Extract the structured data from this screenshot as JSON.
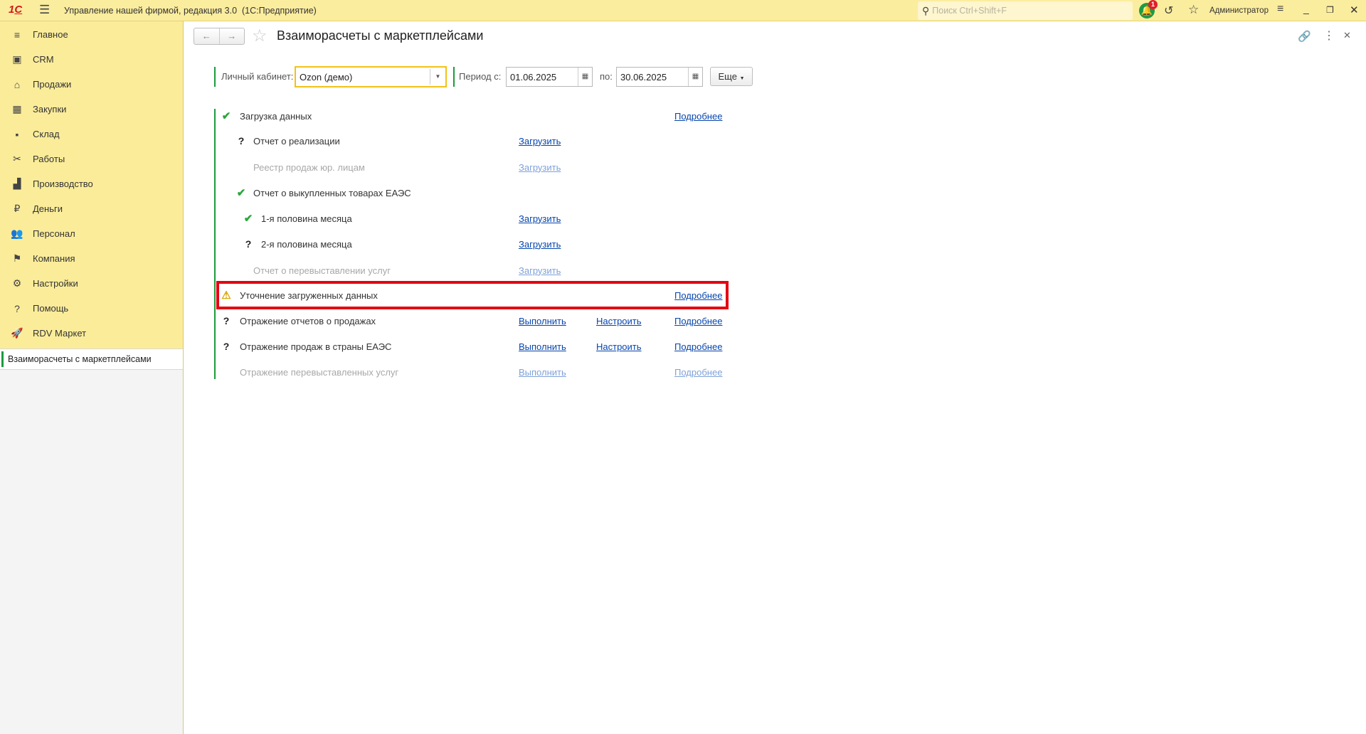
{
  "app": {
    "title": "Управление нашей фирмой, редакция 3.0  (1С:Предприятие)",
    "logo": "1С",
    "search_placeholder": "Поиск Ctrl+Shift+F",
    "notification_count": "1",
    "user": "Администратор"
  },
  "sidebar": {
    "items": [
      {
        "label": "Главное",
        "icon": "≡"
      },
      {
        "label": "CRM",
        "icon": "▣"
      },
      {
        "label": "Продажи",
        "icon": "⌂"
      },
      {
        "label": "Закупки",
        "icon": "▦"
      },
      {
        "label": "Склад",
        "icon": "▪"
      },
      {
        "label": "Работы",
        "icon": "✂"
      },
      {
        "label": "Производство",
        "icon": "▟"
      },
      {
        "label": "Деньги",
        "icon": "₽"
      },
      {
        "label": "Персонал",
        "icon": "👥"
      },
      {
        "label": "Компания",
        "icon": "⚑"
      },
      {
        "label": "Настройки",
        "icon": "⚙"
      },
      {
        "label": "Помощь",
        "icon": "?"
      },
      {
        "label": "RDV Маркет",
        "icon": "🚀"
      }
    ],
    "open_window": "Взаиморасчеты с маркетплейсами"
  },
  "page": {
    "title": "Взаиморасчеты с маркетплейсами"
  },
  "filters": {
    "cabinet_label": "Личный кабинет:",
    "cabinet_value": "Ozon (демо)",
    "period_from_label": "Период с:",
    "period_from": "01.06.2025",
    "period_to_label": "по:",
    "period_to": "30.06.2025",
    "more": "Еще"
  },
  "rows": [
    {
      "status": "check",
      "label": "Загрузка данных",
      "details": "Подробнее"
    },
    {
      "status": "question",
      "label": "Отчет о реализации",
      "action": "Загрузить"
    },
    {
      "status": "none",
      "label": "Реестр продаж юр. лицам",
      "action": "Загрузить"
    },
    {
      "status": "check",
      "label": "Отчет о выкупленных товарах ЕАЭС"
    },
    {
      "status": "check",
      "label": "1-я половина месяца",
      "action": "Загрузить"
    },
    {
      "status": "question",
      "label": "2-я половина месяца",
      "action": "Загрузить"
    },
    {
      "status": "none",
      "label": "Отчет о перевыставлении услуг",
      "action": "Загрузить"
    },
    {
      "status": "warning",
      "label": "Уточнение загруженных данных",
      "details": "Подробнее"
    },
    {
      "status": "question",
      "label": "Отражение отчетов о продажах",
      "action": "Выполнить",
      "setup": "Настроить",
      "details": "Подробнее"
    },
    {
      "status": "question",
      "label": "Отражение продаж в страны ЕАЭС",
      "action": "Выполнить",
      "setup": "Настроить",
      "details": "Подробнее"
    },
    {
      "status": "none",
      "label": "Отражение перевыставленных услуг",
      "action": "Выполнить",
      "details": "Подробнее"
    }
  ],
  "colors": {
    "accent_green": "#1a9c3c",
    "highlight_red": "#e30613",
    "panel_yellow": "#fbec9a"
  }
}
